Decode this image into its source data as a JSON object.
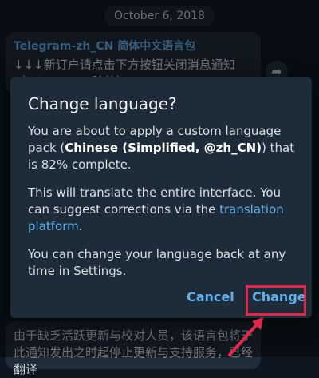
{
  "chat": {
    "date": "October 6, 2018",
    "message1": {
      "sender": "Telegram-zh_CN 简体中文语言包",
      "text": "↓↓↓新订户请点击下方按钮关闭消息通知（Telegram X除外）↓↓↓"
    },
    "message2": {
      "text": "由于缺乏活跃更新与校对人员，该语言包将于此通知发出之时起停止更新与支持服务，已经翻译"
    },
    "forward_icon": "share-arrow-icon"
  },
  "dialog": {
    "title": "Change language?",
    "para1_pre": "You are about to apply a custom language pack (",
    "para1_bold": "Chinese (Simplified, @zh_CN)",
    "para1_post": ") that is 82% complete.",
    "para2_pre": "This will translate the entire interface. You can suggest corrections via the ",
    "para2_link": "translation platform",
    "para2_post": ".",
    "para3": "You can change your language back at any time in Settings.",
    "cancel_label": "Cancel",
    "change_label": "Change"
  },
  "colors": {
    "accent": "#5fb0ec",
    "highlight": "#e3264a",
    "dialog_bg": "#1e2c3a"
  }
}
